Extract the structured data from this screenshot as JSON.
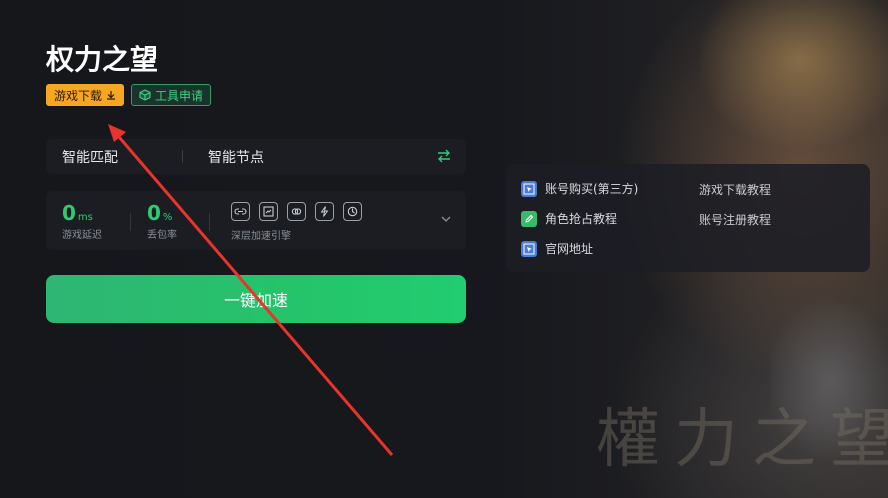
{
  "game": {
    "title": "权力之望",
    "watermark": "權力之望"
  },
  "buttons": {
    "download_label": "游戏下载",
    "download_icon": "download-icon",
    "tool_label": "工具申请",
    "tool_icon": "cube-icon",
    "accelerate_label": "一键加速"
  },
  "route": {
    "mode_label": "智能匹配",
    "node_label": "智能节点",
    "swap_icon": "swap-arrows-icon"
  },
  "stats": {
    "latency": {
      "value": "0",
      "unit": "ms",
      "label": "游戏延迟"
    },
    "loss": {
      "value": "0",
      "unit": "%",
      "label": "丢包率"
    },
    "engine_label": "深层加速引擎",
    "engine_icons": [
      "link-icon",
      "screen-icon",
      "chain-icon",
      "lightning-icon",
      "rocket-icon"
    ]
  },
  "links": [
    {
      "label": "账号购买(第三方)",
      "icon": "cursor-window-icon",
      "color": "#4a7bd6"
    },
    {
      "label": "角色抢占教程",
      "icon": "edit-icon",
      "color": "#3bb96a"
    },
    {
      "label": "官网地址",
      "icon": "cursor-window-icon",
      "color": "#4a7bd6"
    },
    {
      "label": "游戏下载教程"
    },
    {
      "label": "账号注册教程"
    }
  ],
  "colors": {
    "accent_green": "#2ecc71",
    "download_orange": "#f5a623",
    "annotation_red": "#e8342a"
  }
}
